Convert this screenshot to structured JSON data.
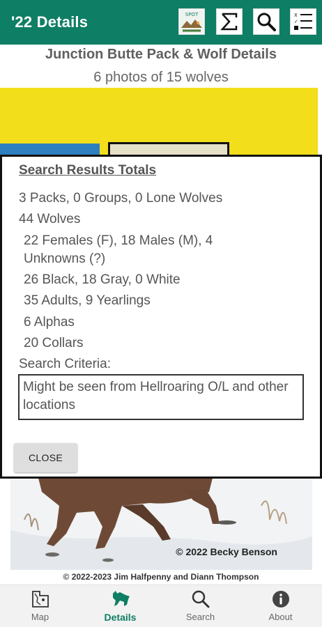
{
  "appbar": {
    "title": "'22 Details",
    "icons": [
      "spotting-guide-icon",
      "sigma-icon",
      "search-icon",
      "list-filter-icon"
    ]
  },
  "header": {
    "pack_title": "Junction Butte Pack & Wolf Details",
    "photo_count": "6 photos of 15 wolves"
  },
  "dialog": {
    "title": "Search Results Totals",
    "lines": [
      "3 Packs, 0 Groups, 0 Lone Wolves",
      "44 Wolves",
      "22 Females (F), 18 Males (M), 4",
      "Unknowns (?)",
      "26 Black, 18 Gray, 0 White",
      "35 Adults, 9 Yearlings",
      "6 Alphas",
      "20 Collars"
    ],
    "criteria_label": "Search Criteria:",
    "criteria_value": "Might be seen from Hellroaring O/L and other locations",
    "close_label": "CLOSE"
  },
  "photo": {
    "credit": "© 2022 Becky Benson"
  },
  "footer": {
    "copyright": "© 2022-2023 Jim Halfpenny and Diann Thompson"
  },
  "nav": {
    "items": [
      {
        "label": "Map",
        "icon": "map-icon"
      },
      {
        "label": "Details",
        "icon": "wolf-icon"
      },
      {
        "label": "Search",
        "icon": "search-icon"
      },
      {
        "label": "About",
        "icon": "info-icon"
      }
    ],
    "active": "Details"
  },
  "colors": {
    "brand": "#0e7e64",
    "photo_yellow": "#f2de1a",
    "photo_blue": "#2d7fc0"
  }
}
